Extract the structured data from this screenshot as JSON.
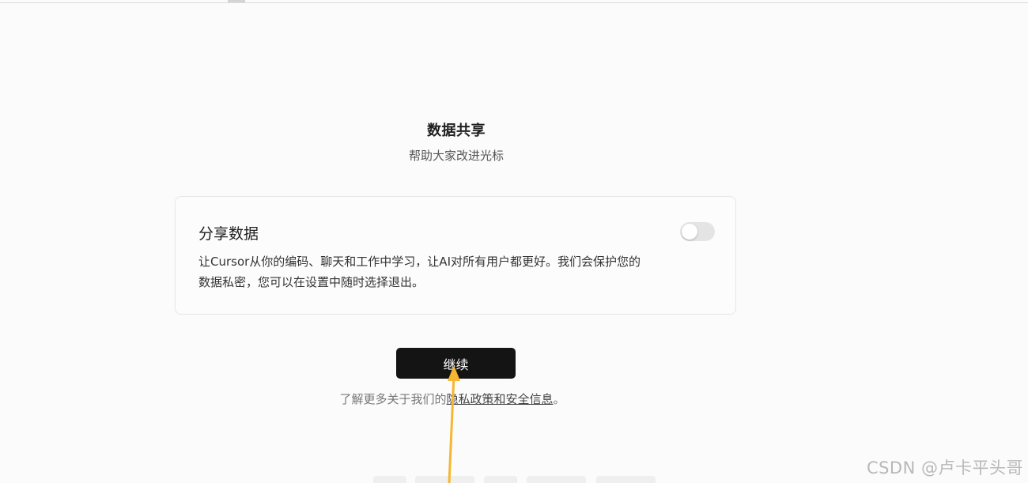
{
  "header": {
    "title": "数据共享",
    "subtitle": "帮助大家改进光标"
  },
  "card": {
    "title": "分享数据",
    "description": "让Cursor从你的编码、聊天和工作中学习，让AI对所有用户都更好。我们会保护您的数据私密，您可以在设置中随时选择退出。",
    "toggle_state": "off"
  },
  "actions": {
    "continue_label": "继续"
  },
  "footer": {
    "privacy_prefix": "了解更多关于我们的",
    "privacy_link": "隐私政策和安全信息",
    "privacy_suffix": "。"
  },
  "annotation": {
    "arrow_color": "#f5b731"
  },
  "watermark": {
    "text": "CSDN @卢卡平头哥"
  }
}
